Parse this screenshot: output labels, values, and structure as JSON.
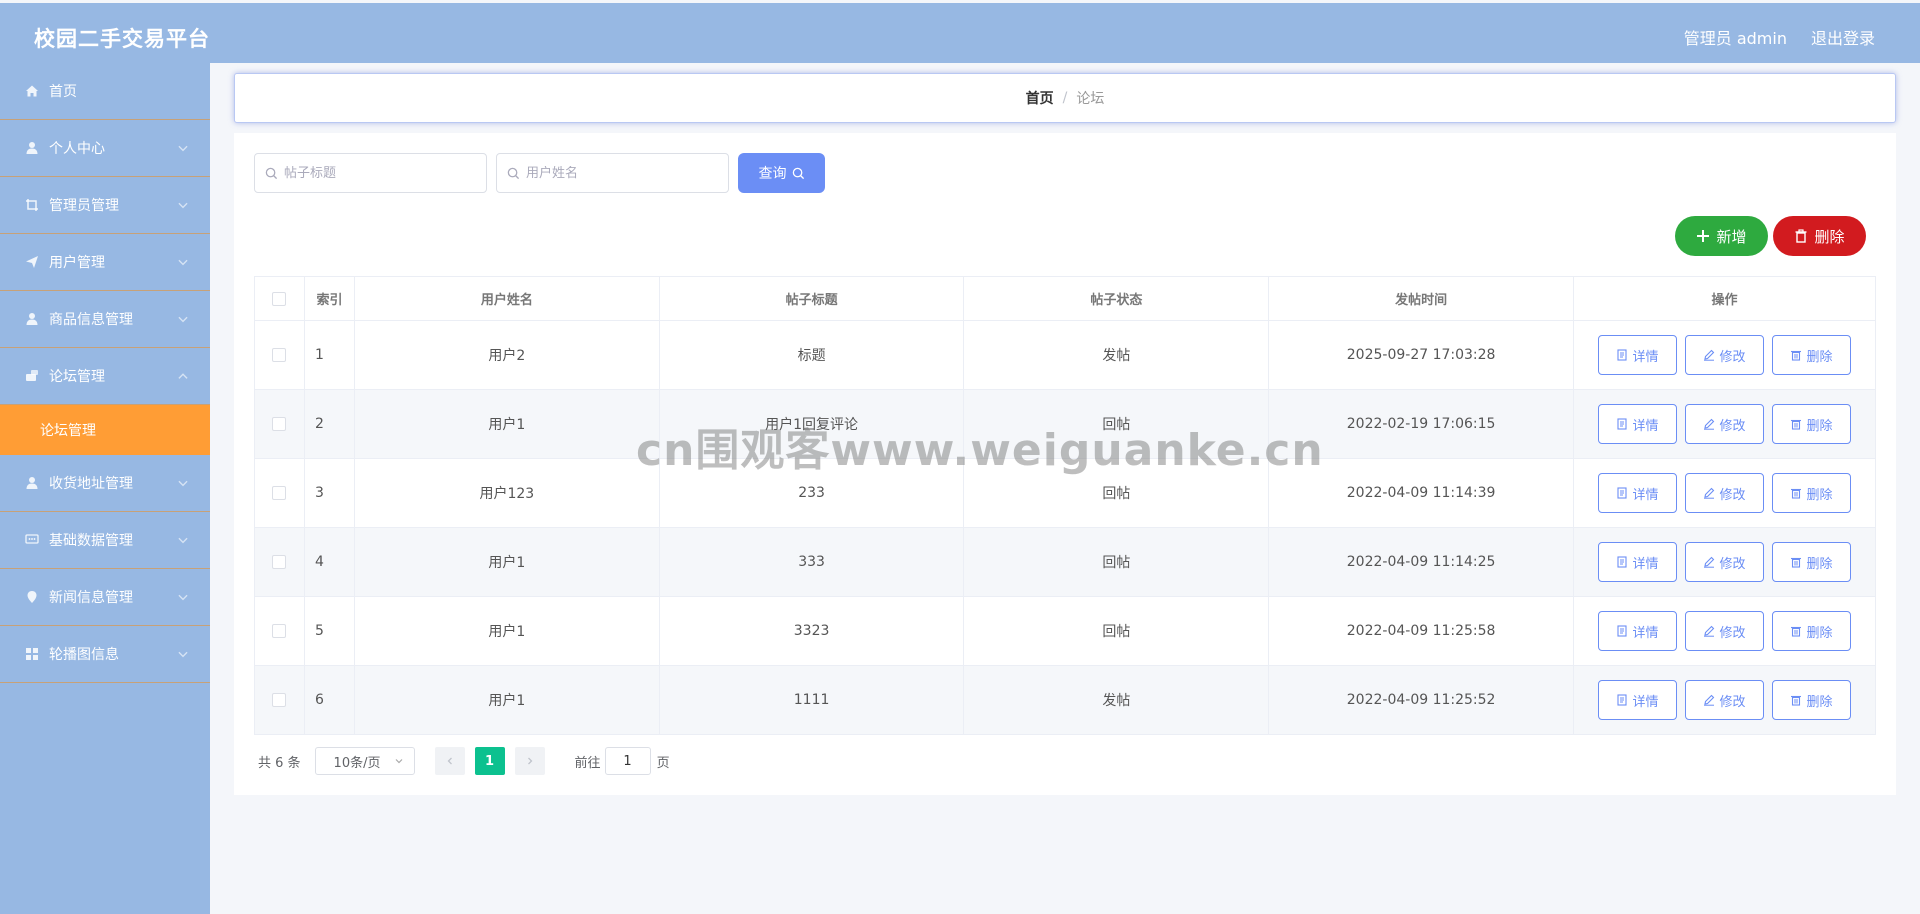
{
  "app": {
    "title": "校园二手交易平台",
    "admin_label": "管理员 admin",
    "logout_label": "退出登录"
  },
  "sidebar": {
    "items": [
      {
        "label": "首页",
        "icon": "home-icon"
      },
      {
        "label": "个人中心",
        "icon": "user-icon"
      },
      {
        "label": "管理员管理",
        "icon": "crop-icon"
      },
      {
        "label": "用户管理",
        "icon": "paper-plane-icon"
      },
      {
        "label": "商品信息管理",
        "icon": "user-icon"
      },
      {
        "label": "论坛管理",
        "icon": "forum-icon",
        "expanded": true
      },
      {
        "label": "收货地址管理",
        "icon": "user-icon"
      },
      {
        "label": "基础数据管理",
        "icon": "chat-icon"
      },
      {
        "label": "新闻信息管理",
        "icon": "location-icon"
      },
      {
        "label": "轮播图信息",
        "icon": "grid-icon"
      }
    ],
    "active_sub": "论坛管理"
  },
  "breadcrumb": {
    "home": "首页",
    "separator": "/",
    "current": "论坛"
  },
  "search": {
    "title_placeholder": "帖子标题",
    "user_placeholder": "用户姓名",
    "query_label": "查询"
  },
  "actions": {
    "add_label": "新增",
    "delete_label": "删除"
  },
  "table": {
    "headers": {
      "index": "索引",
      "user": "用户姓名",
      "title": "帖子标题",
      "status": "帖子状态",
      "time": "发帖时间",
      "ops": "操作"
    },
    "op_labels": {
      "detail": "详情",
      "edit": "修改",
      "delete": "删除"
    },
    "rows": [
      {
        "index": "1",
        "user": "用户2",
        "title": "标题",
        "status": "发帖",
        "time": "2025-09-27 17:03:28"
      },
      {
        "index": "2",
        "user": "用户1",
        "title": "用户1回复评论",
        "status": "回帖",
        "time": "2022-02-19 17:06:15"
      },
      {
        "index": "3",
        "user": "用户123",
        "title": "233",
        "status": "回帖",
        "time": "2022-04-09 11:14:39"
      },
      {
        "index": "4",
        "user": "用户1",
        "title": "333",
        "status": "回帖",
        "time": "2022-04-09 11:14:25"
      },
      {
        "index": "5",
        "user": "用户1",
        "title": "3323",
        "status": "回帖",
        "time": "2022-04-09 11:25:58"
      },
      {
        "index": "6",
        "user": "用户1",
        "title": "1111",
        "status": "发帖",
        "time": "2022-04-09 11:25:52"
      }
    ]
  },
  "pagination": {
    "total": "共 6 条",
    "page_size": "10条/页",
    "current_page": "1",
    "goto_label": "前往",
    "goto_value": "1",
    "page_suffix": "页"
  },
  "watermark": "cn围观客www.weiguanke.cn",
  "colors": {
    "header_bg": "#97b8e3",
    "active_sub_bg": "#ff9d35",
    "primary": "#6b8ef5",
    "success": "#2eaa3f",
    "danger": "#d21b1f",
    "pager_active": "#0cc18f"
  }
}
